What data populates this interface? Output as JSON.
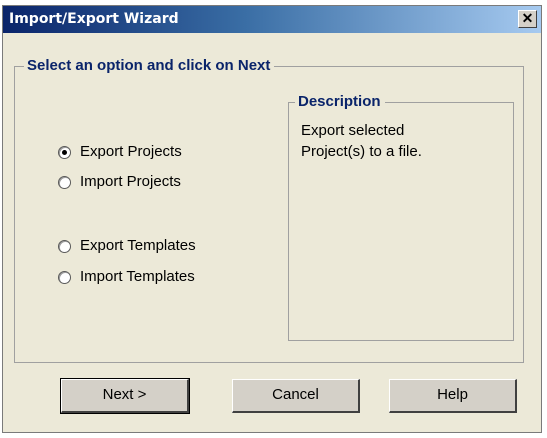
{
  "window": {
    "title": "Import/Export Wizard",
    "close_glyph": "✕"
  },
  "options_group": {
    "legend": "Select an option and click on Next",
    "options": [
      {
        "label": "Export Projects",
        "selected": true
      },
      {
        "label": "Import Projects",
        "selected": false
      },
      {
        "label": "Export Templates",
        "selected": false
      },
      {
        "label": "Import Templates",
        "selected": false
      }
    ]
  },
  "description": {
    "legend": "Description",
    "line1": "Export selected",
    "line2": "Project(s) to a file."
  },
  "buttons": {
    "next": "Next >",
    "cancel": "Cancel",
    "help": "Help"
  },
  "colors": {
    "title_start": "#0a246a",
    "title_end": "#a6caf0",
    "dialog_bg": "#ece9d8",
    "legend_text": "#0a246a"
  },
  "icons": {
    "close": "close-icon",
    "radio": "radio-button"
  }
}
